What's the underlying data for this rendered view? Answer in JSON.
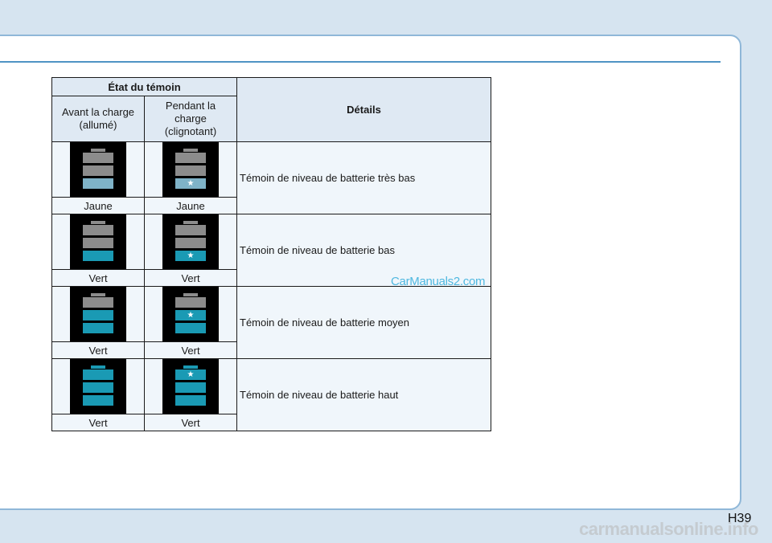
{
  "table": {
    "header_state": "État du témoin",
    "header_details": "Détails",
    "header_before": "Avant la charge\n(allumé)",
    "header_during": "Pendant la\ncharge\n(clignotant)",
    "rows": [
      {
        "before_color": "Jaune",
        "during_color": "Jaune",
        "detail": "Témoin de niveau de batterie très bas"
      },
      {
        "before_color": "Vert",
        "during_color": "Vert",
        "detail": "Témoin de niveau de batterie bas"
      },
      {
        "before_color": "Vert",
        "during_color": "Vert",
        "detail": "Témoin de niveau de batterie moyen"
      },
      {
        "before_color": "Vert",
        "during_color": "Vert",
        "detail": "Témoin de niveau de batterie haut"
      }
    ]
  },
  "watermark": "CarManuals2.com",
  "page_number": "H39",
  "footer_watermark": "carmanualsonline.info",
  "colors": {
    "accent": "#4f93c4",
    "teal": "#1a9ab4",
    "pale_blue": "#7fb3c8",
    "gray": "#8c8c8c"
  }
}
